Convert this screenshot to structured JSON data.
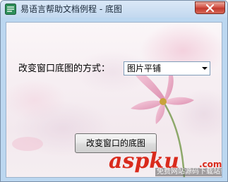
{
  "window": {
    "title": "易语言帮助文档例程 - 底图",
    "close_icon": "close-x-icon",
    "app_icon": "app-logo-icon"
  },
  "form": {
    "label": "改变窗口底图的方式：",
    "select": {
      "selected": "图片平铺",
      "arrow_icon": "dropdown-arrow-icon"
    },
    "button_label": "改变窗口的底图"
  },
  "watermark": {
    "brand": "aspku",
    "tld": ".com",
    "subtitle": "免费网站源码下载站!"
  },
  "colors": {
    "watermark_red": "#d92a1c",
    "close_red": "#c23a2e",
    "flower_pink": "#e5a4bf"
  }
}
